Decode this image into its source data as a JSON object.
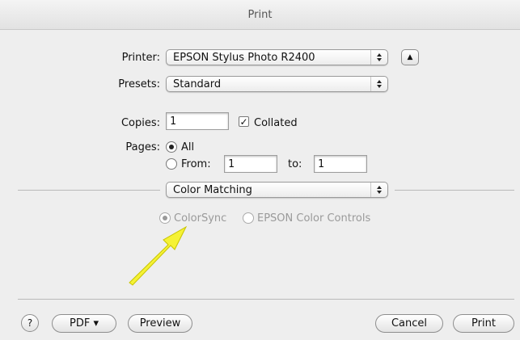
{
  "window": {
    "title": "Print"
  },
  "printer": {
    "label": "Printer:",
    "value": "EPSON Stylus Photo R2400",
    "disclosure_glyph": "▲"
  },
  "presets": {
    "label": "Presets:",
    "value": "Standard"
  },
  "copies": {
    "label": "Copies:",
    "value": "1",
    "collated_label": "Collated",
    "collated_checked": true
  },
  "pages": {
    "label": "Pages:",
    "all_label": "All",
    "from_label": "From:",
    "from_value": "1",
    "to_label": "to:",
    "to_value": "1",
    "selected": "All"
  },
  "panel": {
    "value": "Color Matching"
  },
  "color_matching": {
    "options": [
      "ColorSync",
      "EPSON Color Controls"
    ],
    "selected": "ColorSync",
    "enabled": false
  },
  "annotation": {
    "arrow_color": "#f5f235"
  },
  "footer": {
    "help_label": "?",
    "pdf_label": "PDF ▾",
    "preview_label": "Preview",
    "cancel_label": "Cancel",
    "print_label": "Print"
  }
}
